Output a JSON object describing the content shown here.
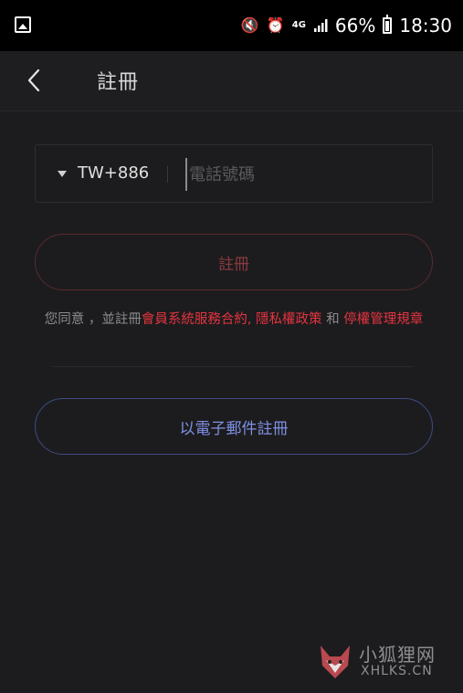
{
  "status_bar": {
    "battery": "66%",
    "time": "18:30",
    "network": "4G"
  },
  "header": {
    "title": "註冊"
  },
  "phone": {
    "country_code": "TW+886",
    "placeholder": "電話號碼",
    "value": ""
  },
  "register_button": {
    "label": "註冊"
  },
  "agreement": {
    "prefix": "您同意 ，並註冊",
    "link1": "會員系統服務合約",
    "sep": ", ",
    "link2": "隱私權政策",
    "and": " 和 ",
    "link3": "停權管理規章"
  },
  "email_button": {
    "label": "以電子郵件註冊"
  },
  "watermark": {
    "cn": "小狐狸网",
    "en": "XHLKS.CN"
  },
  "colors": {
    "link": "#e5343f",
    "email_accent": "#7f90e4",
    "background": "#1c1c1e"
  }
}
